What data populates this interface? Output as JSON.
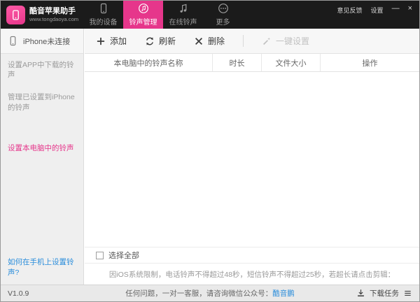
{
  "titlebar": {
    "app_name": "酷音苹果助手",
    "website": "www.tongdaoya.com",
    "feedback": "意见反馈",
    "settings": "设置",
    "minimize": "—",
    "close": "×",
    "tabs": [
      {
        "label": "我的设备",
        "icon": "device-icon",
        "active": false
      },
      {
        "label": "铃声管理",
        "icon": "ringtone-icon",
        "active": true
      },
      {
        "label": "在线铃声",
        "icon": "music-note-icon",
        "active": false
      },
      {
        "label": "更多",
        "icon": "more-icon",
        "active": false
      }
    ]
  },
  "sidebar": {
    "connection_status": "iPhone未连接",
    "items": [
      {
        "label": "设置APP中下载的铃声",
        "active": false
      },
      {
        "label": "管理已设置到iPhone的铃声",
        "active": false
      },
      {
        "label": "设置本电脑中的铃声",
        "active": true
      }
    ],
    "help_link": "如何在手机上设置铃声?"
  },
  "toolbar": {
    "add": "添加",
    "refresh": "刷新",
    "delete": "删除",
    "onekey": "一键设置"
  },
  "table": {
    "headers": [
      "本电脑中的铃声名称",
      "时长",
      "文件大小",
      "操作"
    ],
    "rows": []
  },
  "footer": {
    "select_all": "选择全部",
    "notice": "因iOS系统限制，电话铃声不得超过48秒，短信铃声不得超过25秒，若超长请点击剪辑："
  },
  "statusbar": {
    "version": "V1.0.9",
    "support_text": "任何问题，一对一客服，请咨询微信公众号：",
    "support_link": "酷音鹏",
    "download_label": "下载任务"
  },
  "colors": {
    "accent": "#e6368b",
    "link": "#2a8ddb"
  }
}
